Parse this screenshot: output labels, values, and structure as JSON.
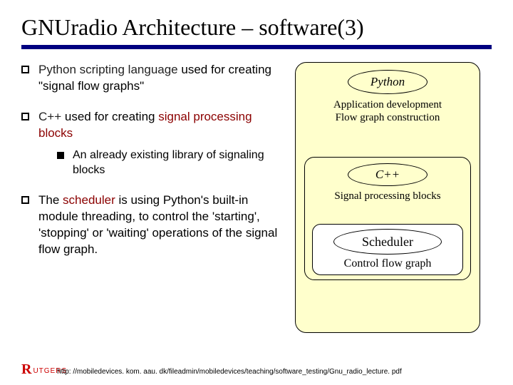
{
  "title": "GNUradio Architecture – software(3)",
  "bullets": {
    "b1_pre": "Python scripting language",
    "b1_post": " used for creating \"signal flow graphs\"",
    "b2_pre": "C++",
    "b2_mid": " used for creating ",
    "b2_kw": "signal processing blocks",
    "b2_sub": "An already existing library of signaling blocks",
    "b3_pre": "The ",
    "b3_kw": "scheduler",
    "b3_post": " is using Python's built-in module threading, to control the 'starting', 'stopping' or 'waiting' operations of the signal flow graph."
  },
  "diagram": {
    "python": "Python",
    "outer1": "Application development",
    "outer2": "Flow graph construction",
    "cxx": "C++",
    "inner": "Signal processing blocks",
    "sched": "Scheduler",
    "sched_text": "Control flow graph"
  },
  "footer": {
    "logo_r": "R",
    "logo_text": "UTGERS",
    "url": "http: //mobiledevices. kom. aau. dk/fileadmin/mobiledevices/teaching/software_testing/Gnu_radio_lecture. pdf"
  }
}
